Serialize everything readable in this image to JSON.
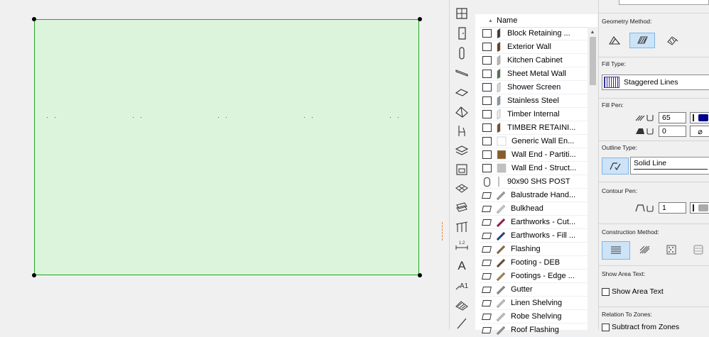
{
  "list": {
    "header_name": "Name",
    "items": [
      {
        "label": "Block Retaining ...",
        "kind": "wall",
        "color": "#3a3a3a"
      },
      {
        "label": "Exterior Wall",
        "kind": "wall",
        "color": "#6b3b1f"
      },
      {
        "label": "Kitchen Cabinet",
        "kind": "wall",
        "color": "#b8b8b8"
      },
      {
        "label": "Sheet Metal Wall",
        "kind": "wall",
        "color": "#4f6f55"
      },
      {
        "label": "Shower Screen",
        "kind": "wall",
        "color": "#dadada"
      },
      {
        "label": "Stainless Steel",
        "kind": "wall",
        "color": "#8a96a6"
      },
      {
        "label": "Timber Internal",
        "kind": "wall",
        "color": "#ececec"
      },
      {
        "label": "TIMBER RETAINI...",
        "kind": "wall",
        "color": "#7a4a24"
      },
      {
        "label": "Generic Wall En...",
        "kind": "wallend",
        "color": "#ffffff"
      },
      {
        "label": "Wall End - Partiti...",
        "kind": "wallend",
        "color": "#8a5a2a"
      },
      {
        "label": "Wall End - Struct...",
        "kind": "wallend",
        "color": "#c0c0c0"
      },
      {
        "label": "90x90 SHS POST",
        "kind": "obj",
        "color": "#aaaaaa"
      },
      {
        "label": "Balustrade Hand...",
        "kind": "slab",
        "color": "#9a9a9a"
      },
      {
        "label": "Bulkhead",
        "kind": "slab",
        "color": "#c4c4c4"
      },
      {
        "label": "Earthworks - Cut...",
        "kind": "slab",
        "color": "#9b1a4a"
      },
      {
        "label": "Earthworks - Fill ...",
        "kind": "slab",
        "color": "#1b3f8a"
      },
      {
        "label": "Flashing",
        "kind": "slab",
        "color": "#8a6a3a"
      },
      {
        "label": "Footing - DEB",
        "kind": "slab",
        "color": "#6a4a2a"
      },
      {
        "label": "Footings - Edge ...",
        "kind": "slab",
        "color": "#a08040"
      },
      {
        "label": "Gutter",
        "kind": "slab",
        "color": "#888888"
      },
      {
        "label": "Linen Shelving",
        "kind": "slab",
        "color": "#bdbdbd"
      },
      {
        "label": "Robe Shelving",
        "kind": "slab",
        "color": "#bdbdbd"
      },
      {
        "label": "Roof Flashing",
        "kind": "slab",
        "color": "#909090"
      }
    ]
  },
  "settings": {
    "geometry_method_label": "Geometry Method:",
    "fill_type_label": "Fill Type:",
    "fill_type_value": "Staggered Lines",
    "fill_pen_label": "Fill Pen:",
    "fill_pen_value": "65",
    "fill_bg_pen_value": "0",
    "fill_pen_color": "#00008b",
    "outline_type_label": "Outline Type:",
    "outline_type_value": "Solid Line",
    "contour_pen_label": "Contour Pen:",
    "contour_pen_value": "1",
    "construction_method_label": "Construction Method:",
    "show_area_text_label": "Show Area Text:",
    "show_area_text_checkbox": "Show Area Text",
    "relation_to_zones_label": "Relation To Zones:",
    "subtract_from_zones": "Subtract from Zones"
  },
  "colors": {
    "fill_green": "#dcf3dc",
    "outline_green": "#27a527",
    "selection_blue": "#cde3f7"
  }
}
